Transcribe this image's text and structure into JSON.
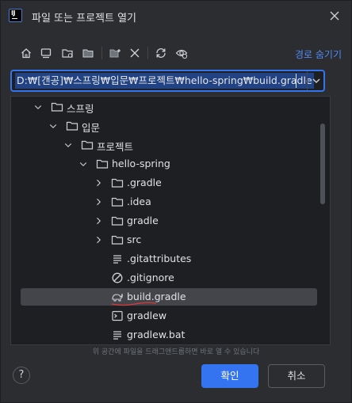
{
  "dialog": {
    "title": "파일 또는 프로젝트 열기"
  },
  "toolbar": {
    "icons": [
      "home-icon",
      "desktop-icon",
      "project-folder-icon",
      "module-folder-icon",
      "new-folder-icon",
      "delete-icon",
      "refresh-icon",
      "show-hidden-icon"
    ],
    "hide_path_label": "경로 숨기기"
  },
  "path": {
    "value": "D:₩[갠공]₩스프링₩입문₩프로젝트₩hello-spring₩build.gradle"
  },
  "tree": {
    "items": [
      {
        "label": "스프링",
        "type": "folder",
        "expanded": true
      },
      {
        "label": "입문",
        "type": "folder",
        "expanded": true
      },
      {
        "label": "프로젝트",
        "type": "folder",
        "expanded": true
      },
      {
        "label": "hello-spring",
        "type": "folder",
        "expanded": true
      },
      {
        "label": ".gradle",
        "type": "folder",
        "expanded": false
      },
      {
        "label": ".idea",
        "type": "folder",
        "expanded": false
      },
      {
        "label": "gradle",
        "type": "folder",
        "expanded": false
      },
      {
        "label": "src",
        "type": "folder",
        "expanded": false
      },
      {
        "label": ".gitattributes",
        "type": "text-file"
      },
      {
        "label": ".gitignore",
        "type": "ignore-file"
      },
      {
        "label": "build.gradle",
        "type": "gradle-file",
        "selected": true
      },
      {
        "label": "gradlew",
        "type": "shell-file"
      },
      {
        "label": "gradlew.bat",
        "type": "text-file"
      }
    ]
  },
  "hint": "위 공간에 파일을 드래그앤드롭하면 바로 열 수 있습니다",
  "footer": {
    "help_label": "?",
    "ok_label": "확인",
    "cancel_label": "취소"
  },
  "colors": {
    "accent": "#3574f0",
    "link": "#548af7",
    "background": "#2b2d30",
    "tree_background": "#1e1f22",
    "selection": "#43454a"
  }
}
